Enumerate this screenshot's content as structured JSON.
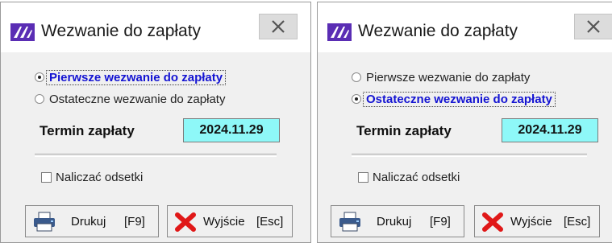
{
  "dialogs": [
    {
      "title": "Wezwanie do zapłaty",
      "options": [
        {
          "label": "Pierwsze wezwanie do zapłaty",
          "checked": true
        },
        {
          "label": "Ostateczne wezwanie do zapłaty",
          "checked": false
        }
      ],
      "term_label": "Termin zapłaty",
      "term_value": "2024.11.29",
      "interest_label": "Naliczać odsetki",
      "interest_checked": false,
      "print_label": "Drukuj",
      "print_key": "[F9]",
      "exit_label": "Wyjście",
      "exit_key": "[Esc]"
    },
    {
      "title": "Wezwanie do zapłaty",
      "options": [
        {
          "label": "Pierwsze wezwanie do zapłaty",
          "checked": false
        },
        {
          "label": "Ostateczne wezwanie do zapłaty",
          "checked": true
        }
      ],
      "term_label": "Termin zapłaty",
      "term_value": "2024.11.29",
      "interest_label": "Naliczać odsetki",
      "interest_checked": false,
      "print_label": "Drukuj",
      "print_key": "[F9]",
      "exit_label": "Wyjście",
      "exit_key": "[Esc]"
    }
  ],
  "colors": {
    "selected_text": "#1414d2",
    "date_field_bg": "#8ef8f8",
    "app_icon": "#5a2db4",
    "exit_icon": "#e01818"
  },
  "icons": {
    "app": "app-logo-icon",
    "close": "close-icon",
    "print": "printer-icon",
    "exit": "red-x-icon"
  }
}
